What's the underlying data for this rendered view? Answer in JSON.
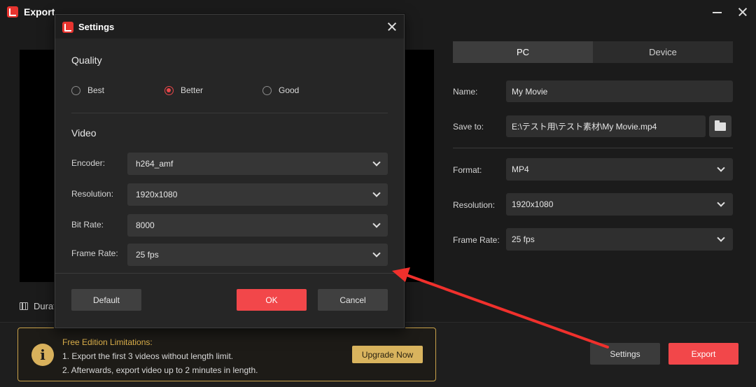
{
  "window": {
    "title": "Export"
  },
  "preview": {
    "duration_label": "Durat"
  },
  "tabs": [
    {
      "label": "PC"
    },
    {
      "label": "Device"
    }
  ],
  "fields": {
    "name_label": "Name:",
    "name_value": "My Movie",
    "save_label": "Save to:",
    "save_value": "E:\\テスト用\\テスト素材\\My Movie.mp4",
    "format_label": "Format:",
    "format_value": "MP4",
    "resolution_label": "Resolution:",
    "resolution_value": "1920x1080",
    "framerate_label": "Frame Rate:",
    "framerate_value": "25 fps"
  },
  "limits": {
    "title": "Free Edition Limitations:",
    "line1": "1. Export the first 3 videos without length limit.",
    "line2": "2. Afterwards, export video up to 2 minutes in length.",
    "upgrade_label": "Upgrade Now"
  },
  "footer": {
    "settings_label": "Settings",
    "export_label": "Export"
  },
  "settings": {
    "title": "Settings",
    "quality_title": "Quality",
    "quality_options": [
      {
        "label": "Best",
        "checked": false
      },
      {
        "label": "Better",
        "checked": true
      },
      {
        "label": "Good",
        "checked": false
      }
    ],
    "video_title": "Video",
    "encoder_label": "Encoder:",
    "encoder_value": "h264_amf",
    "resolution_label": "Resolution:",
    "resolution_value": "1920x1080",
    "bitrate_label": "Bit Rate:",
    "bitrate_value": "8000",
    "framerate_label": "Frame Rate:",
    "framerate_value": "25 fps",
    "default_label": "Default",
    "ok_label": "OK",
    "cancel_label": "Cancel"
  },
  "colors": {
    "accent": "#f2474a",
    "gold": "#d9b45e",
    "annotation_arrow": "#f0302c"
  }
}
